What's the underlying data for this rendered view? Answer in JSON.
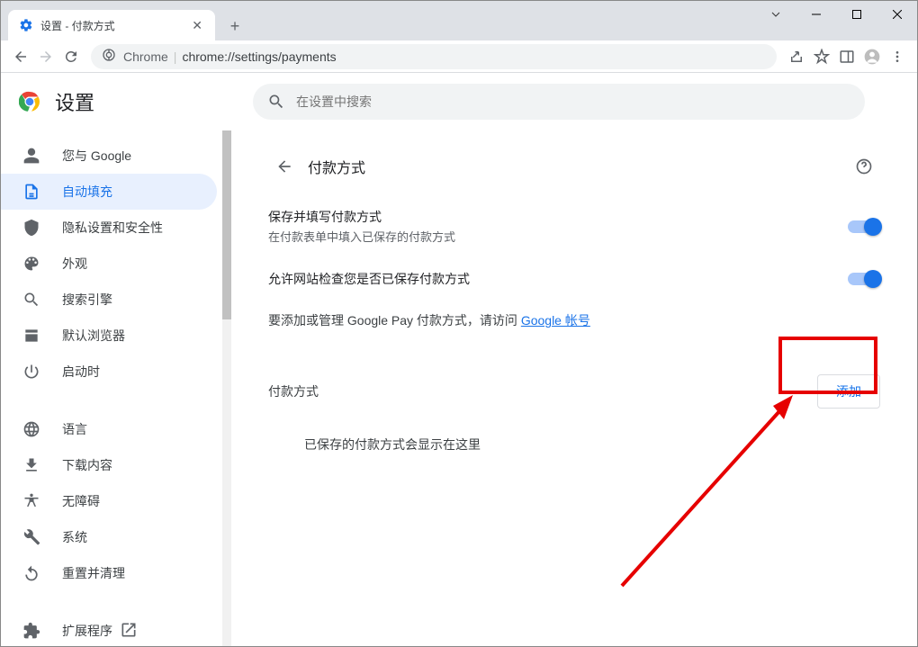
{
  "window": {
    "tab_title": "设置 - 付款方式",
    "url_prefix": "Chrome",
    "url_path": "chrome://settings/payments"
  },
  "header": {
    "title": "设置",
    "search_placeholder": "在设置中搜索"
  },
  "sidebar": {
    "items": [
      {
        "label": "您与 Google"
      },
      {
        "label": "自动填充"
      },
      {
        "label": "隐私设置和安全性"
      },
      {
        "label": "外观"
      },
      {
        "label": "搜索引擎"
      },
      {
        "label": "默认浏览器"
      },
      {
        "label": "启动时"
      }
    ],
    "items2": [
      {
        "label": "语言"
      },
      {
        "label": "下载内容"
      },
      {
        "label": "无障碍"
      },
      {
        "label": "系统"
      },
      {
        "label": "重置并清理"
      }
    ],
    "extensions": "扩展程序"
  },
  "panel": {
    "title": "付款方式",
    "toggle1_title": "保存并填写付款方式",
    "toggle1_sub": "在付款表单中填入已保存的付款方式",
    "toggle2_title": "允许网站检查您是否已保存付款方式",
    "gpay_prefix": "要添加或管理 Google Pay 付款方式，请访问 ",
    "gpay_link": "Google 帐号",
    "section_label": "付款方式",
    "add_button": "添加",
    "empty_text": "已保存的付款方式会显示在这里"
  }
}
